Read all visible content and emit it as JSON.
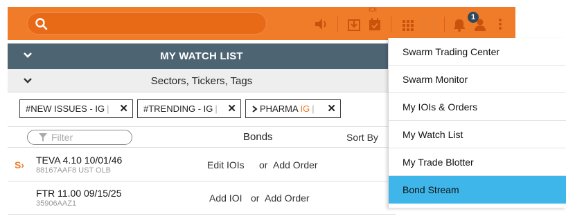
{
  "toolbar": {
    "search_placeholder": "",
    "ioi_label": "IOI",
    "notification_count": "1",
    "accent_color": "#f07c2a",
    "icons": [
      "search-icon",
      "speaker-icon",
      "ioi-download-icon",
      "calendar-icon",
      "grid-apps-icon",
      "fullscreen-icon",
      "bell-icon",
      "user-icon",
      "more-vertical-icon"
    ]
  },
  "watchlist": {
    "title": "MY WATCH LIST",
    "sectors_title": "Sectors, Tickers, Tags",
    "tags": [
      {
        "label": "#NEW ISSUES - IG",
        "suffix": ""
      },
      {
        "label": "#TRENDING - IG",
        "suffix": ""
      },
      {
        "label": "PHARMA",
        "suffix": "IG"
      }
    ],
    "filter_placeholder": "Filter",
    "bonds_header": "Bonds",
    "sort_by": "Sort By",
    "rows": [
      {
        "flag": "S›",
        "name": "TEVA 4.10 10/01/46",
        "sub": "88167AAF8 UST OLB",
        "action1": "Edit IOIs",
        "or": "or",
        "action2": "Add Order"
      },
      {
        "flag": "",
        "name": "FTR 11.00 09/15/25",
        "sub": "35906AAZ1",
        "action1": "Add IOI",
        "or": "or",
        "action2": "Add Order"
      }
    ]
  },
  "menu": {
    "items": [
      {
        "label": "Swarm Trading Center"
      },
      {
        "label": "Swarm Monitor"
      },
      {
        "label": "My IOIs & Orders"
      },
      {
        "label": "My Watch List"
      },
      {
        "label": "My Trade Blotter"
      },
      {
        "label": "Bond Stream"
      }
    ],
    "active_index": 5,
    "active_color": "#3fb6ea"
  }
}
